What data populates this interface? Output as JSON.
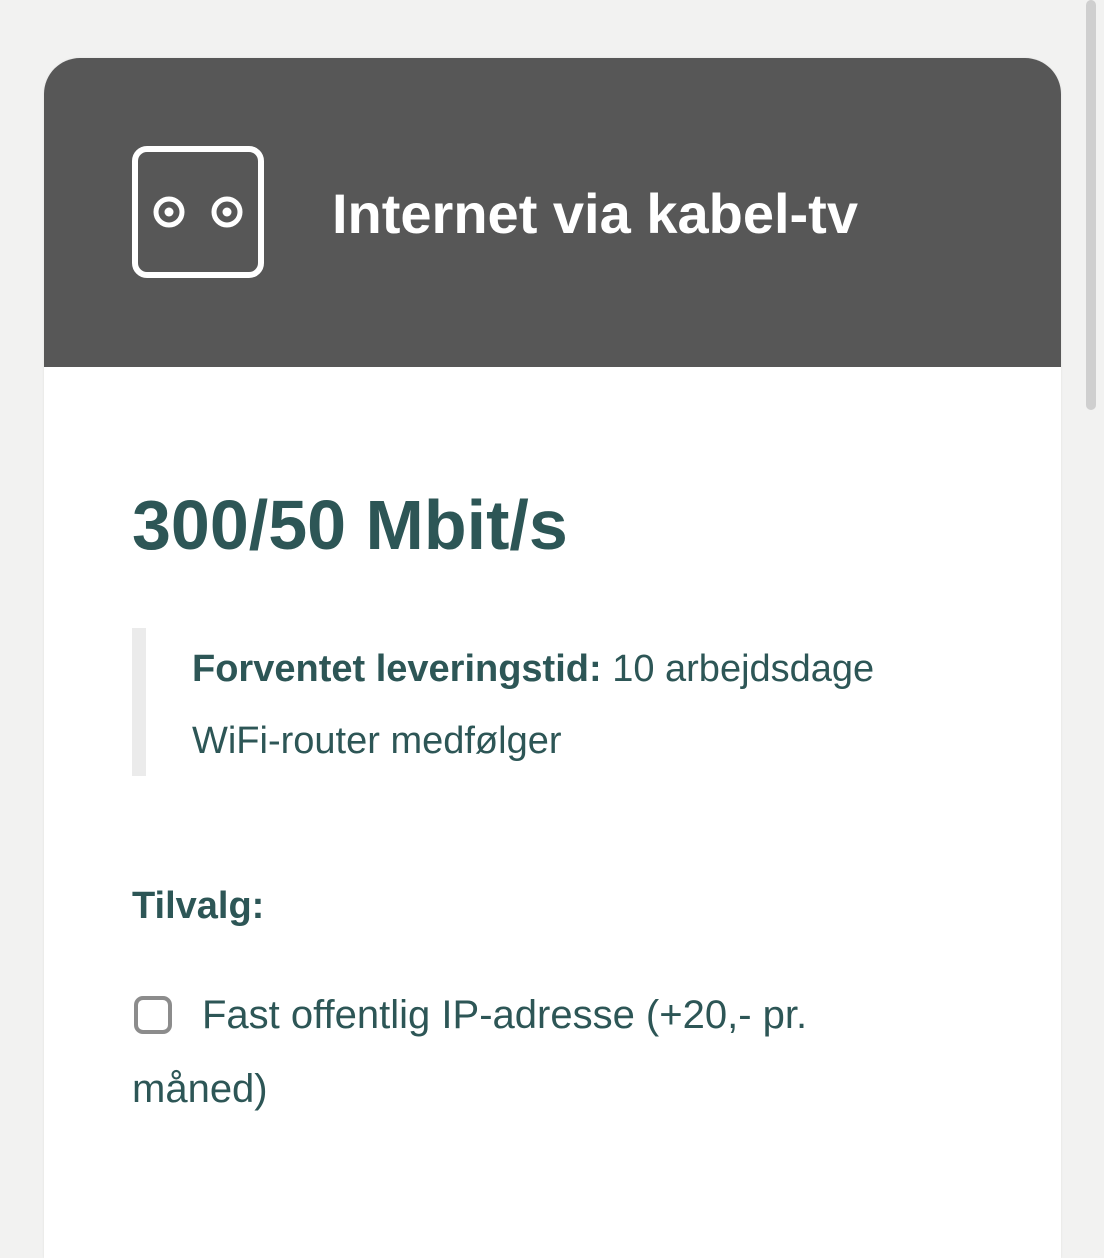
{
  "header": {
    "icon": "tv-socket-icon",
    "title": "Internet via kabel-tv"
  },
  "product": {
    "speed": "300/50 Mbit/s"
  },
  "info": {
    "delivery_label": "Forventet leveringstid:",
    "delivery_value": " 10 arbejdsdage",
    "router_note": "WiFi-router medfølger"
  },
  "addons": {
    "heading": "Tilvalg:",
    "options": [
      {
        "label": "Fast offentlig IP-adresse (+20,- pr. måned)",
        "checked": false
      }
    ]
  },
  "colors": {
    "header_bg": "#575757",
    "text_accent": "#2d5656",
    "page_bg": "#f2f2f1"
  }
}
